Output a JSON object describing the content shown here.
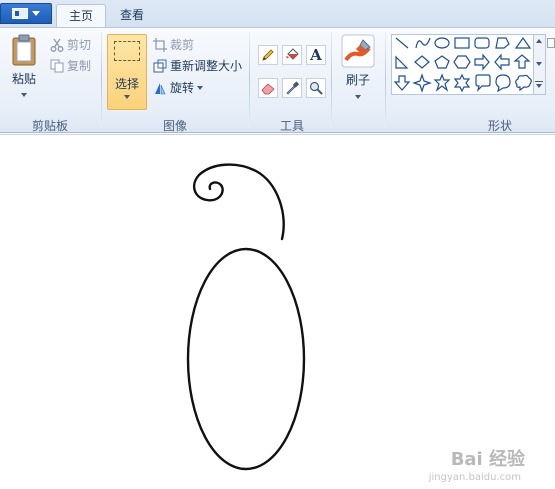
{
  "titlebar": {
    "tabs": [
      {
        "label": "主页",
        "active": true
      },
      {
        "label": "查看",
        "active": false
      }
    ]
  },
  "ribbon": {
    "clipboard": {
      "paste_label": "粘贴",
      "cut_label": "剪切",
      "copy_label": "复制",
      "group_label": "剪贴板"
    },
    "image": {
      "select_label": "选择",
      "crop_label": "裁剪",
      "resize_label": "重新调整大小",
      "rotate_label": "旋转",
      "group_label": "图像"
    },
    "tools": {
      "group_label": "工具",
      "items": [
        "pencil-icon",
        "fill-icon",
        "text-icon",
        "eraser-icon",
        "color-picker-icon",
        "magnifier-icon"
      ]
    },
    "brushes": {
      "label": "刷子"
    },
    "shapes": {
      "group_label": "形状",
      "items": [
        "line",
        "curve",
        "oval",
        "rectangle",
        "rounded-rectangle",
        "polygon",
        "triangle",
        "right-triangle",
        "diamond",
        "pentagon",
        "hexagon",
        "right-arrow",
        "left-arrow",
        "up-arrow",
        "down-arrow",
        "four-point-star",
        "five-point-star",
        "six-point-star",
        "rounded-callout",
        "oval-callout",
        "cloud-callout"
      ]
    }
  },
  "watermark": {
    "brand": "Bai 经验",
    "url": "jingyan.baidu.com"
  },
  "colors": {
    "accent": "#1c5db8",
    "selected_button": "#fbd27a",
    "ribbon_bg": "#e7eef8"
  }
}
